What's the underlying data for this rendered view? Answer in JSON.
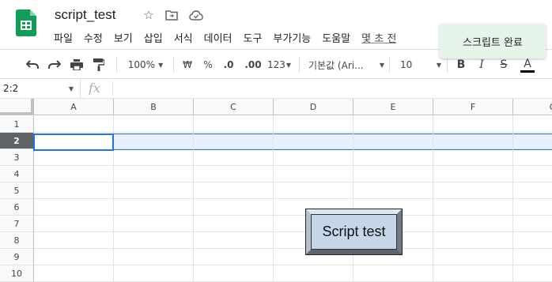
{
  "document": {
    "title": "script_test"
  },
  "menu": [
    {
      "id": "file",
      "label": "파일"
    },
    {
      "id": "edit",
      "label": "수정"
    },
    {
      "id": "view",
      "label": "보기"
    },
    {
      "id": "insert",
      "label": "삽입"
    },
    {
      "id": "format",
      "label": "서식"
    },
    {
      "id": "data",
      "label": "데이터"
    },
    {
      "id": "tools",
      "label": "도구"
    },
    {
      "id": "addons",
      "label": "부가기능"
    },
    {
      "id": "help",
      "label": "도움말"
    }
  ],
  "last_edit_fragment": "몇 초 전",
  "toast": {
    "message": "스크립트 완료"
  },
  "toolbar": {
    "zoom": "100%",
    "currency": "₩",
    "percent": "%",
    "decrease_decimal": ".0",
    "increase_decimal": ".00",
    "more_formats": "123",
    "font": "기본값 (Ari...",
    "font_size": "10",
    "bold": "B",
    "italic": "I",
    "strike": "S",
    "text_color": "A"
  },
  "formula_bar": {
    "cell_ref": "2:2",
    "fx": "fx",
    "value": ""
  },
  "columns": [
    "A",
    "B",
    "C",
    "D",
    "E",
    "F",
    "G"
  ],
  "rows": [
    "1",
    "2",
    "3",
    "4",
    "5",
    "6",
    "7",
    "8",
    "9",
    "10"
  ],
  "selection": {
    "active_row": "2",
    "active_cell": "A2"
  },
  "drawing_button": {
    "label": "Script test"
  },
  "colors": {
    "sheets_green": "#0f9d58",
    "selection_blue": "#1a73e8",
    "row_highlight": "#e8f0fe",
    "toast_bg": "#e6f4ea",
    "button_face": "#c6d7ea"
  }
}
